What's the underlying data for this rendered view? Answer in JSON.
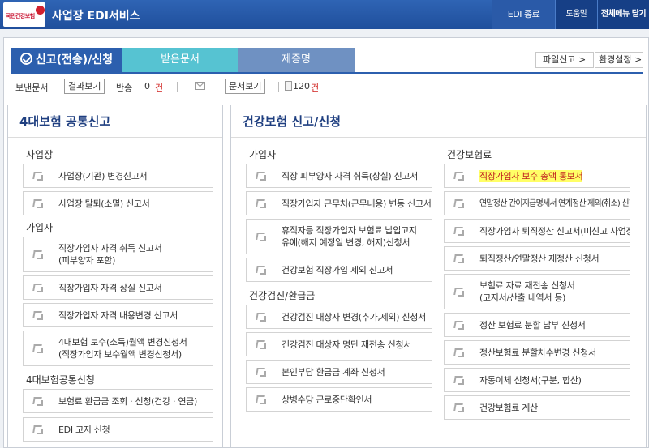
{
  "topbar": {
    "logo_text": "국민건강보험",
    "title": "사업장 EDI서비스",
    "edi_exit": "EDI 종료",
    "help": "도움말",
    "menu_close": "전체메뉴 닫기"
  },
  "tabs": {
    "send": "신고(전송)/신청",
    "received": "받은문서",
    "certificate": "제증명"
  },
  "toolbar": {
    "file_report": "파일신고 >",
    "settings": "환경설정 >"
  },
  "status": {
    "sent_label": "보낸문서",
    "result_button": "결과보기",
    "returned_label": "반송",
    "returned_count": "0",
    "unit": "건",
    "doc_button": "문서보기",
    "doc_count": "120",
    "doc_unit": "건"
  },
  "left": {
    "title": "4대보험 공통신고",
    "sec1": "사업장",
    "sec1_items": [
      "사업장(기관) 변경신고서",
      "사업장 탈퇴(소멸) 신고서"
    ],
    "sec2": "가입자",
    "sec2_items": [
      {
        "line1": "직장가입자 자격 취득 신고서",
        "line2": "(피부양자 포함)"
      },
      {
        "line1": "직장가입자 자격 상실 신고서",
        "line2": ""
      },
      {
        "line1": "직장가입자 자격 내용변경 신고서",
        "line2": ""
      },
      {
        "line1": "4대보험 보수(소득)월액 변경신청서",
        "line2": "(직장가입자 보수월액 변경신청서)"
      }
    ],
    "sec3": "4대보험공통신청",
    "sec3_items": [
      "보험료 환급금 조회 · 신청(건강 · 연금)",
      "EDI 고지 신청"
    ]
  },
  "right": {
    "title": "건강보험 신고/신청",
    "col1": {
      "sec1": "가입자",
      "sec1_items": [
        {
          "line1": "직장 피부양자 자격 취득(상실) 신고서",
          "line2": ""
        },
        {
          "line1": "직장가입자 근무처(근무내용) 변동 신고서",
          "line2": ""
        },
        {
          "line1": "휴직자등 직장가입자 보험료 납입고지",
          "line2": "유예(해지 예정일 변경, 해지)신청서"
        },
        {
          "line1": "건강보험 직장가입 제외 신고서",
          "line2": ""
        }
      ],
      "sec2": "건강검진/환급금",
      "sec2_items": [
        "건강검진 대상자 변경(추가,제외) 신청서",
        "건강검진 대상자 명단 재전송 신청서",
        "본인부담 환급금 계좌 신청서",
        "상병수당 근로중단확인서"
      ]
    },
    "col2": {
      "sec1": "건강보험료",
      "items": [
        {
          "line1": "직장가입자 보수 총액 통보서",
          "line2": ""
        },
        {
          "line1": "연말정산 간이지급명세서 연계정산 제외(취소) 신청",
          "line2": ""
        },
        {
          "line1": "직장가입자 퇴직정산 신고서(미신고 사업장)",
          "line2": ""
        },
        {
          "line1": "퇴직정산/연말정산 재정산 신청서",
          "line2": ""
        },
        {
          "line1": "보험료 자료 재전송 신청서",
          "line2": "(고지서/산출 내역서 등)"
        },
        {
          "line1": "정산 보험료 분할 납부 신청서",
          "line2": ""
        },
        {
          "line1": "정산보험료 분할차수변경 신청서",
          "line2": ""
        },
        {
          "line1": "자동이체 신청서(구분, 합산)",
          "line2": ""
        },
        {
          "line1": "건강보험료 계산",
          "line2": ""
        }
      ]
    }
  },
  "colors": {
    "topbar": "#2a5aa8",
    "tab_active": "#2c5fae",
    "tab_received": "#56c3d2",
    "tab_cert": "#6f91c2",
    "highlight": "#ffff66",
    "alert_red": "#d0201e"
  }
}
